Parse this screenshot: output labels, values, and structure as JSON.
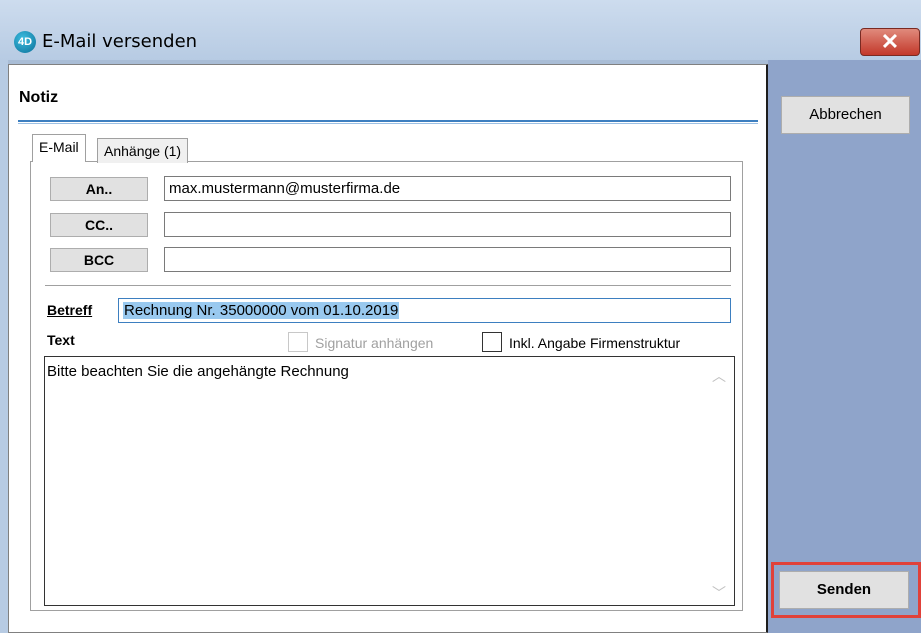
{
  "window": {
    "title": "E-Mail versenden",
    "app_icon": "4D",
    "close_glyph": "✕"
  },
  "header": {
    "title": "Notiz"
  },
  "tabs": [
    {
      "label": "E-Mail",
      "active": true
    },
    {
      "label": "Anhänge (1)",
      "active": false
    }
  ],
  "recipients": {
    "to": {
      "button": "An..",
      "value": "max.mustermann@musterfirma.de"
    },
    "cc": {
      "button": "CC..",
      "value": ""
    },
    "bcc": {
      "button": "BCC",
      "value": ""
    }
  },
  "subject": {
    "label": "Betreff",
    "value": "Rechnung Nr. 35000000 vom 01.10.2019"
  },
  "body": {
    "label": "Text",
    "value": "Bitte beachten Sie die angehängte Rechnung",
    "signature_label": "Signatur anhängen",
    "signature_enabled": false,
    "company_label": "Inkl. Angabe Firmenstruktur",
    "company_checked": false
  },
  "actions": {
    "cancel": "Abbrechen",
    "send": "Senden"
  },
  "colors": {
    "highlight": "#e0413a",
    "side_panel": "#8fa4ca",
    "accent": "#3d7fc0"
  }
}
